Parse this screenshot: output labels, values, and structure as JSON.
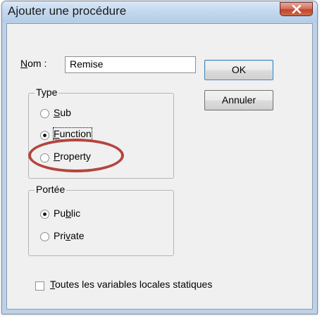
{
  "window": {
    "title": "Ajouter une procédure",
    "close_icon": "close-icon"
  },
  "name_field": {
    "label_mnemonic": "N",
    "label_rest": "om :",
    "value": "Remise"
  },
  "buttons": {
    "ok": "OK",
    "cancel": "Annuler"
  },
  "type_group": {
    "legend": "Type",
    "options": [
      {
        "mnemonic": "S",
        "rest": "ub",
        "selected": false
      },
      {
        "mnemonic": "F",
        "rest": "unction",
        "selected": true
      },
      {
        "mnemonic": "P",
        "rest": "roperty",
        "selected": false
      }
    ]
  },
  "scope_group": {
    "legend": "Portée",
    "options": [
      {
        "prefix": "Pu",
        "mnemonic": "b",
        "rest": "lic",
        "selected": true
      },
      {
        "prefix": "Pri",
        "mnemonic": "v",
        "rest": "ate",
        "selected": false
      }
    ]
  },
  "static_checkbox": {
    "mnemonic": "T",
    "rest": "outes les variables locales statiques",
    "checked": false
  },
  "colors": {
    "highlight": "#b5443f",
    "titlebar": "#c4d8ee",
    "client": "#f0f0f0"
  }
}
